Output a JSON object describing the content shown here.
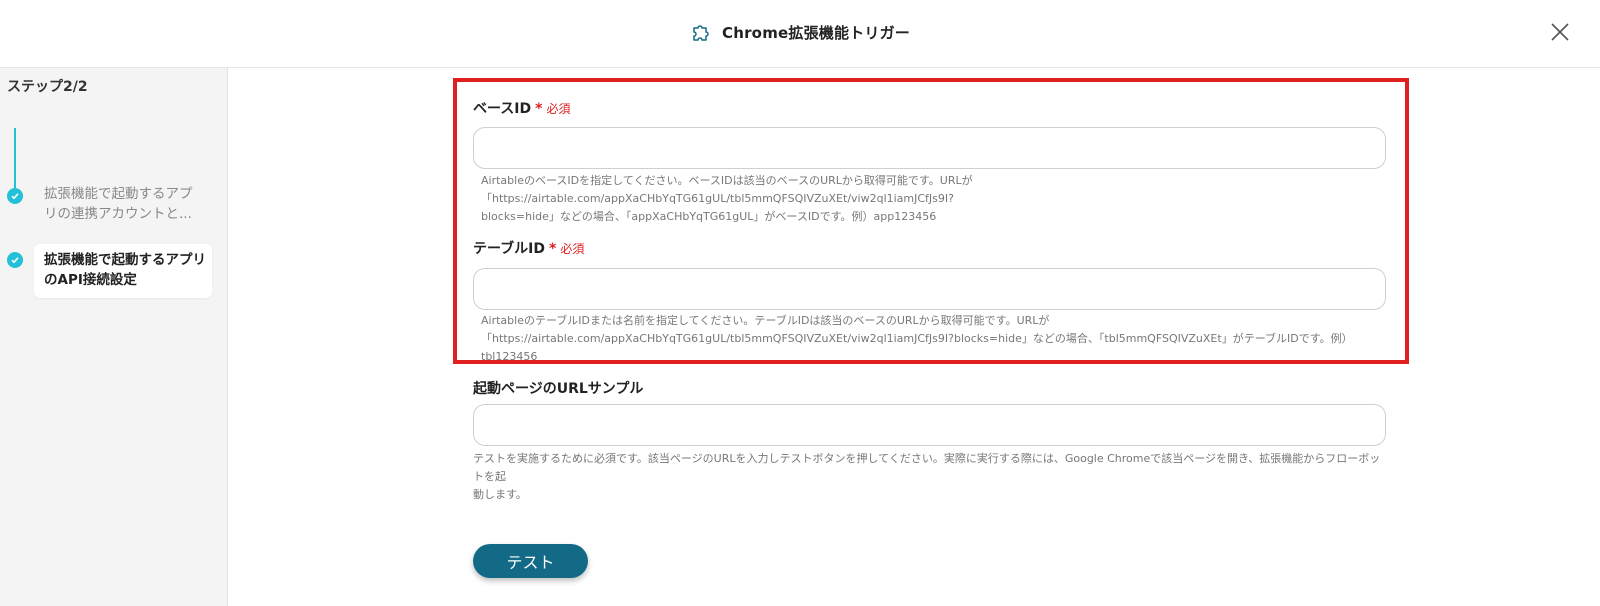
{
  "header": {
    "title": "Chrome拡張機能トリガー",
    "icon": "puzzle-icon"
  },
  "sidebar": {
    "step_counter": "ステップ2/2",
    "steps": [
      {
        "label": "拡張機能で起動するアプリの連携アカウントと...",
        "status": "completed"
      },
      {
        "label": "拡張機能で起動するアプリのAPI接続設定",
        "status": "current"
      }
    ]
  },
  "form": {
    "base_id": {
      "label": "ベースID",
      "required_mark": "*",
      "required_text": "必須",
      "value": "",
      "help_line1": "AirtableのベースIDを指定してください。ベースIDは該当のベースのURLから取得可能です。URLが「https://airtable.com/appXaCHbYqTG61gUL/tbl5mmQFSQIVZuXEt/viw2ql1iamJCfJs9I?",
      "help_line2": "blocks=hide」などの場合、「appXaCHbYqTG61gUL」がベースIDです。例）app123456"
    },
    "table_id": {
      "label": "テーブルID",
      "required_mark": "*",
      "required_text": "必須",
      "value": "",
      "help_line1": "AirtableのテーブルIDまたは名前を指定してください。テーブルIDは該当のベースのURLから取得可能です。URLが",
      "help_line2": "「https://airtable.com/appXaCHbYqTG61gUL/tbl5mmQFSQIVZuXEt/viw2ql1iamJCfJs9I?blocks=hide」などの場合、「tbl5mmQFSQIVZuXEt」がテーブルIDです。例）tbl123456"
    },
    "url_sample": {
      "label": "起動ページのURLサンプル",
      "value": "",
      "help_line1": "テストを実施するために必須です。該当ページのURLを入力しテストボタンを押してください。実際に実行する際には、Google Chromeで該当ページを開き、拡張機能からフローボットを起",
      "help_line2": "動します。"
    },
    "test_button": "テスト"
  },
  "colors": {
    "accent": "#22c1d8",
    "primary_button": "#136a87",
    "highlight": "#e02020",
    "required": "#e02020"
  }
}
